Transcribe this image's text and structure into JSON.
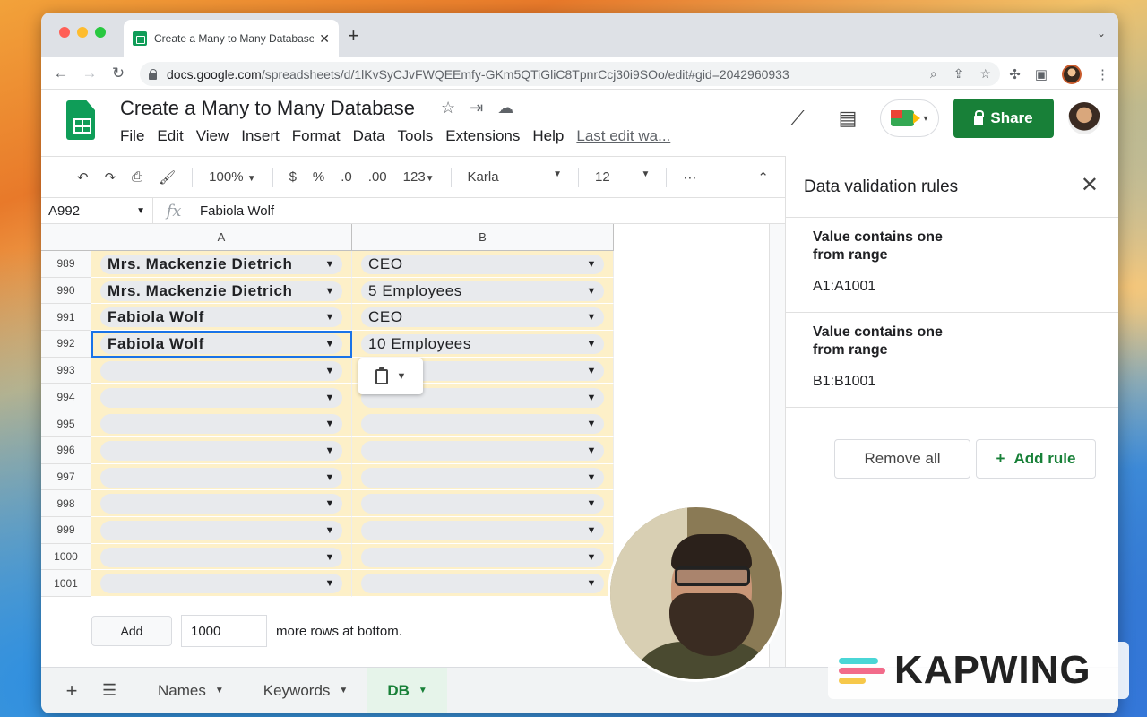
{
  "browser": {
    "tab_title": "Create a Many to Many Database",
    "url_host": "docs.google.com",
    "url_path": "/spreadsheets/d/1lKvSyCJvFWQEEmfy-GKm5QTiGliC8TpnrCcj30i9SOo/edit#gid=2042960933"
  },
  "doc": {
    "title": "Create a Many to Many Database",
    "menu": [
      "File",
      "Edit",
      "View",
      "Insert",
      "Format",
      "Data",
      "Tools",
      "Extensions",
      "Help"
    ],
    "last_edit": "Last edit wa...",
    "share_label": "Share"
  },
  "toolbar": {
    "zoom": "100%",
    "currency": "$",
    "percent": "%",
    "dec_less": ".0",
    "dec_more": ".00",
    "number_format": "123",
    "font": "Karla",
    "font_size": "12",
    "more": "⋯"
  },
  "formula_bar": {
    "cell_ref": "A992",
    "fx": "fx",
    "value": "Fabiola Wolf"
  },
  "grid": {
    "columns": [
      "A",
      "B"
    ],
    "rows": [
      {
        "num": "989",
        "a": "Mrs. Mackenzie Dietrich",
        "b": "CEO"
      },
      {
        "num": "990",
        "a": "Mrs. Mackenzie Dietrich",
        "b": "5 Employees"
      },
      {
        "num": "991",
        "a": "Fabiola Wolf",
        "b": "CEO"
      },
      {
        "num": "992",
        "a": "Fabiola Wolf",
        "b": "10 Employees"
      },
      {
        "num": "993",
        "a": "",
        "b": ""
      },
      {
        "num": "994",
        "a": "",
        "b": ""
      },
      {
        "num": "995",
        "a": "",
        "b": ""
      },
      {
        "num": "996",
        "a": "",
        "b": ""
      },
      {
        "num": "997",
        "a": "",
        "b": ""
      },
      {
        "num": "998",
        "a": "",
        "b": ""
      },
      {
        "num": "999",
        "a": "",
        "b": ""
      },
      {
        "num": "1000",
        "a": "",
        "b": ""
      },
      {
        "num": "1001",
        "a": "",
        "b": ""
      }
    ],
    "add_label": "Add",
    "add_count": "1000",
    "add_suffix": "more rows at bottom."
  },
  "sheet_tabs": [
    {
      "label": "Names",
      "active": false
    },
    {
      "label": "Keywords",
      "active": false
    },
    {
      "label": "DB",
      "active": true
    }
  ],
  "panel": {
    "title": "Data validation rules",
    "rules": [
      {
        "type": "Value contains one from range",
        "range": "A1:A1001"
      },
      {
        "type": "Value contains one from range",
        "range": "B1:B1001"
      }
    ],
    "remove_all": "Remove all",
    "add_rule": "Add rule"
  },
  "watermark": {
    "brand": "KAPWING"
  },
  "colors": {
    "share_green": "#188038",
    "validation_fill": "#fdf0c8",
    "selection_blue": "#1a73e8",
    "kapwing_bars": [
      "#4ad6d6",
      "#f26b8a",
      "#f6c84a"
    ]
  }
}
